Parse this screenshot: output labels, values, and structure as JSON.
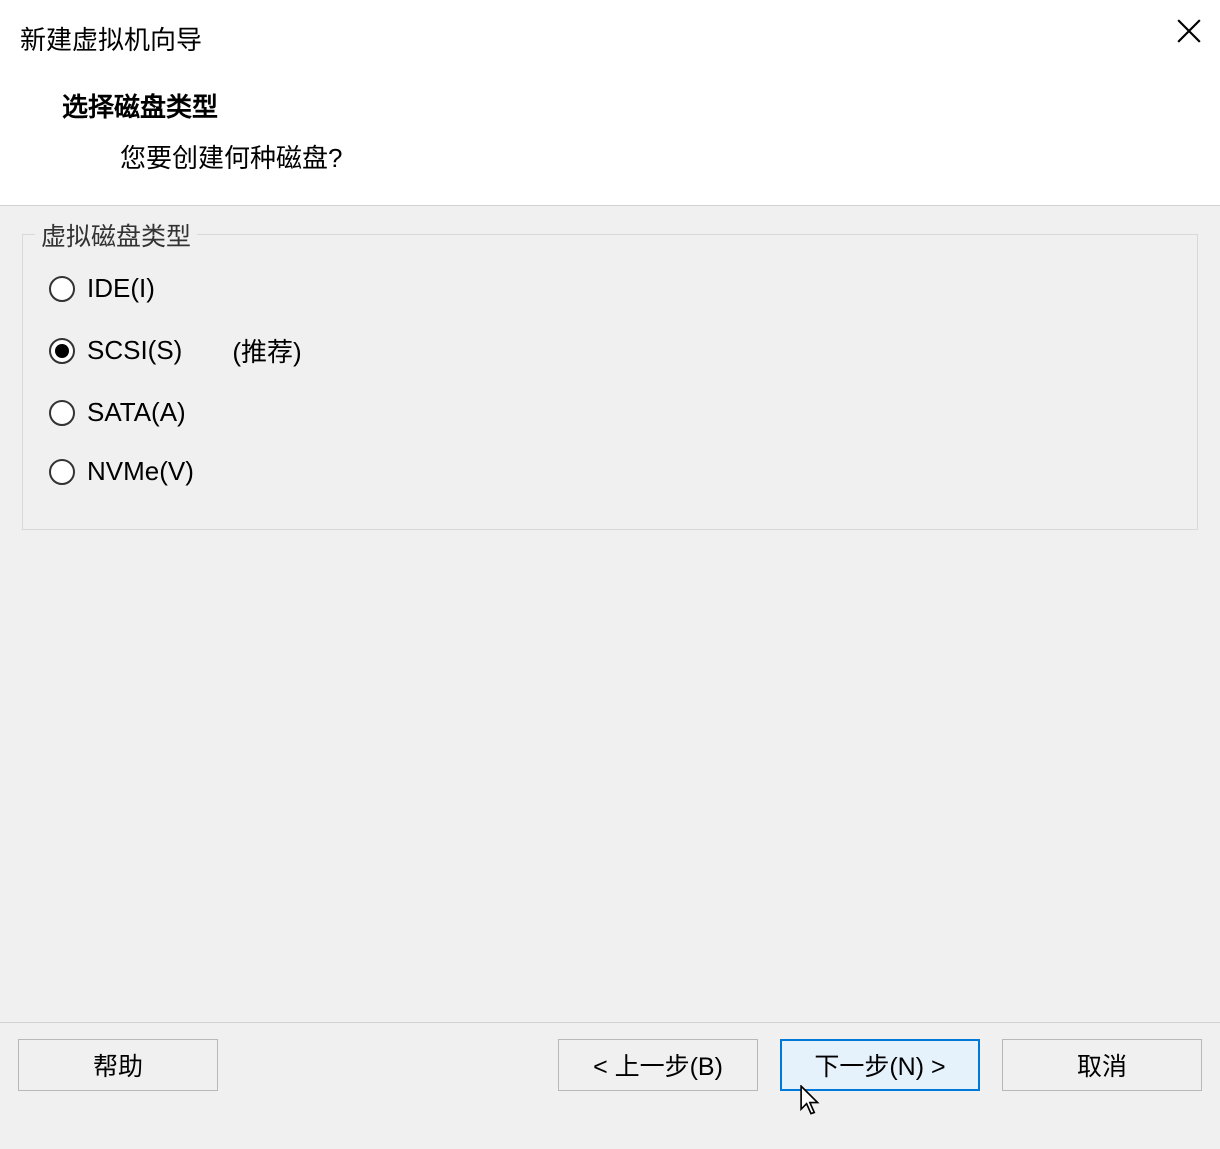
{
  "window": {
    "title": "新建虚拟机向导"
  },
  "section": {
    "title": "选择磁盘类型",
    "subtitle": "您要创建何种磁盘?"
  },
  "fieldset": {
    "legend": "虚拟磁盘类型",
    "options": [
      {
        "label": "IDE(I)",
        "checked": false,
        "note": ""
      },
      {
        "label": "SCSI(S)",
        "checked": true,
        "note": "(推荐)"
      },
      {
        "label": "SATA(A)",
        "checked": false,
        "note": ""
      },
      {
        "label": "NVMe(V)",
        "checked": false,
        "note": ""
      }
    ]
  },
  "buttons": {
    "help": "帮助",
    "back": "< 上一步(B)",
    "next": "下一步(N) >",
    "cancel": "取消"
  }
}
